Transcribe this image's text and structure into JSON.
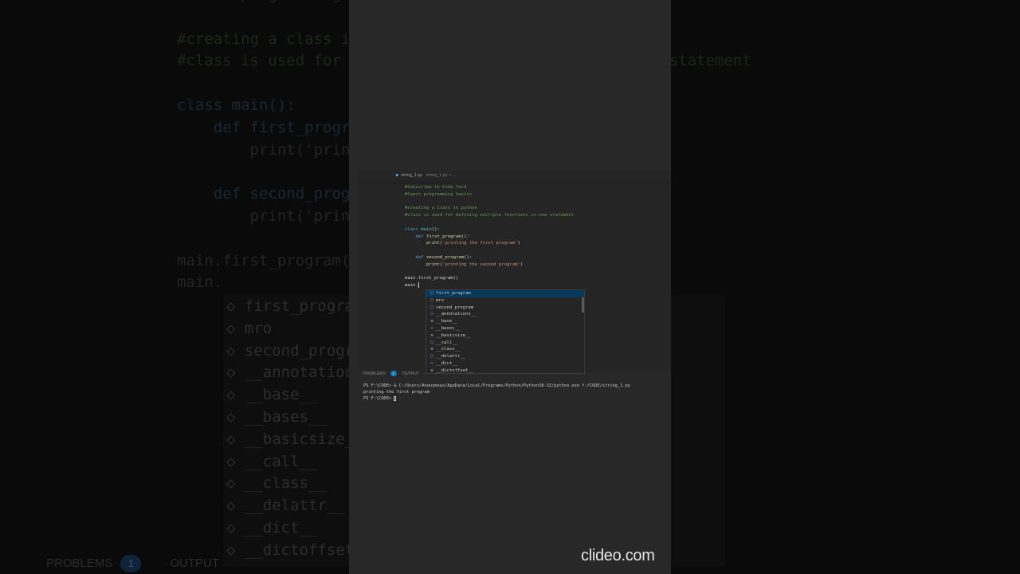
{
  "editor": {
    "tab_label": "string_1.py",
    "breadcrumb": "string_1.py > ...",
    "code_lines": [
      {
        "t": "#Subscribe to Code Yard",
        "cls": "cmt"
      },
      {
        "t": "#learn programming basics",
        "cls": "cmt"
      },
      {
        "t": "",
        "cls": ""
      },
      {
        "t": "#creating a class in python",
        "cls": "cmt"
      },
      {
        "t": "#class is used for defining multiple functions in one statement",
        "cls": "cmt"
      },
      {
        "t": "",
        "cls": ""
      },
      {
        "t": "class main():",
        "cls": "kw"
      },
      {
        "t": "    def first_program():",
        "cls": "kw"
      },
      {
        "t": "        print('printing the first program')",
        "cls": "fn"
      },
      {
        "t": "",
        "cls": ""
      },
      {
        "t": "    def second_program():",
        "cls": "kw"
      },
      {
        "t": "        print('printing the second program')",
        "cls": "fn"
      },
      {
        "t": "",
        "cls": ""
      },
      {
        "t": "main.first_program()",
        "cls": ""
      },
      {
        "t": "main.",
        "cls": "cursor"
      }
    ]
  },
  "suggestions": [
    {
      "label": "first_program",
      "icon": "method",
      "selected": true
    },
    {
      "label": "mro",
      "icon": "method"
    },
    {
      "label": "second_program",
      "icon": "method"
    },
    {
      "label": "__annotations__",
      "icon": "field"
    },
    {
      "label": "__base__",
      "icon": "wrench"
    },
    {
      "label": "__bases__",
      "icon": "field"
    },
    {
      "label": "__basicsize__",
      "icon": "wrench"
    },
    {
      "label": "__call__",
      "icon": "method"
    },
    {
      "label": "__class__",
      "icon": "wrench"
    },
    {
      "label": "__delattr__",
      "icon": "method"
    },
    {
      "label": "__dict__",
      "icon": "field"
    },
    {
      "label": "__dictoffset__",
      "icon": "wrench"
    }
  ],
  "panel": {
    "problems_label": "PROBLEMS",
    "problems_count": "1",
    "output_label": "OUTPUT"
  },
  "terminal": {
    "lines": [
      "PS F:\\CODE> & C:/Users/Anonymous/AppData/Local/Programs/Python/Python38-32/python.exe f:/CODE/string_1.py",
      "printing the first program",
      "PS F:\\CODE> "
    ]
  },
  "background": {
    "code": [
      "#learn programming basics",
      "",
      "#creating a class in python",
      "#class is used for defining multiple functions in one statement",
      "",
      "class main():",
      "    def first_program():",
      "        print('printing the first program')",
      "",
      "    def second_program():",
      "        print('printing the second program')",
      "",
      "main.first_program()",
      "main."
    ],
    "suggestions": [
      "first_program",
      "mro",
      "second_program",
      "__annotations__",
      "__base__",
      "__bases__",
      "__basicsize__",
      "__call__",
      "__class__",
      "__delattr__",
      "__dict__",
      "__dictoffset__"
    ],
    "problems_label": "PROBLEMS",
    "problems_count": "1",
    "output_label": "OUTPUT"
  },
  "watermark": "clideo.com",
  "icons": {
    "method": "cube-icon",
    "field": "field-icon",
    "wrench": "wrench-icon",
    "python": "python-file-icon"
  }
}
